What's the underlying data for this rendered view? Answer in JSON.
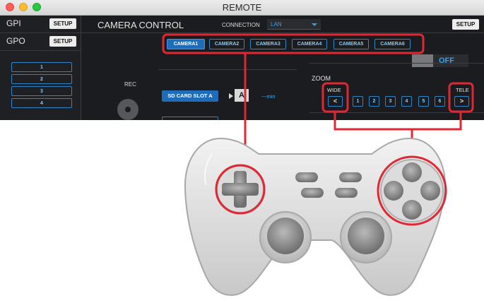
{
  "window": {
    "title": "REMOTE"
  },
  "left_panel": {
    "gpi_label": "GPI",
    "gpo_label": "GPO",
    "setup_label": "SETUP",
    "list_items": [
      "1",
      "2",
      "3",
      "4"
    ]
  },
  "camera_control": {
    "title": "CAMERA CONTROL",
    "connection_label": "CONNECTION",
    "connection_value": "LAN",
    "setup_label": "SETUP",
    "camera_tabs": [
      "CAMERA1",
      "CAMERA2",
      "CAMERA3",
      "CAMERA4",
      "CAMERA5",
      "CAMERA6"
    ],
    "active_camera": "CAMERA1"
  },
  "record": {
    "rec_label": "REC",
    "sd_slot_label": "SD CARD SLOT A",
    "ab_badge": "A",
    "remaining_label": "---min"
  },
  "toggle": {
    "label": "OFF"
  },
  "zoom": {
    "label": "ZOOM",
    "wide_label": "WIDE",
    "tele_label": "TELE",
    "wide_button": "<",
    "tele_button": ">",
    "presets": [
      "1",
      "2",
      "3",
      "4",
      "5",
      "6"
    ]
  },
  "colors": {
    "app_background": "#1b1c1f",
    "accent_blue": "#2e86c8",
    "highlight_red": "#e02834"
  }
}
